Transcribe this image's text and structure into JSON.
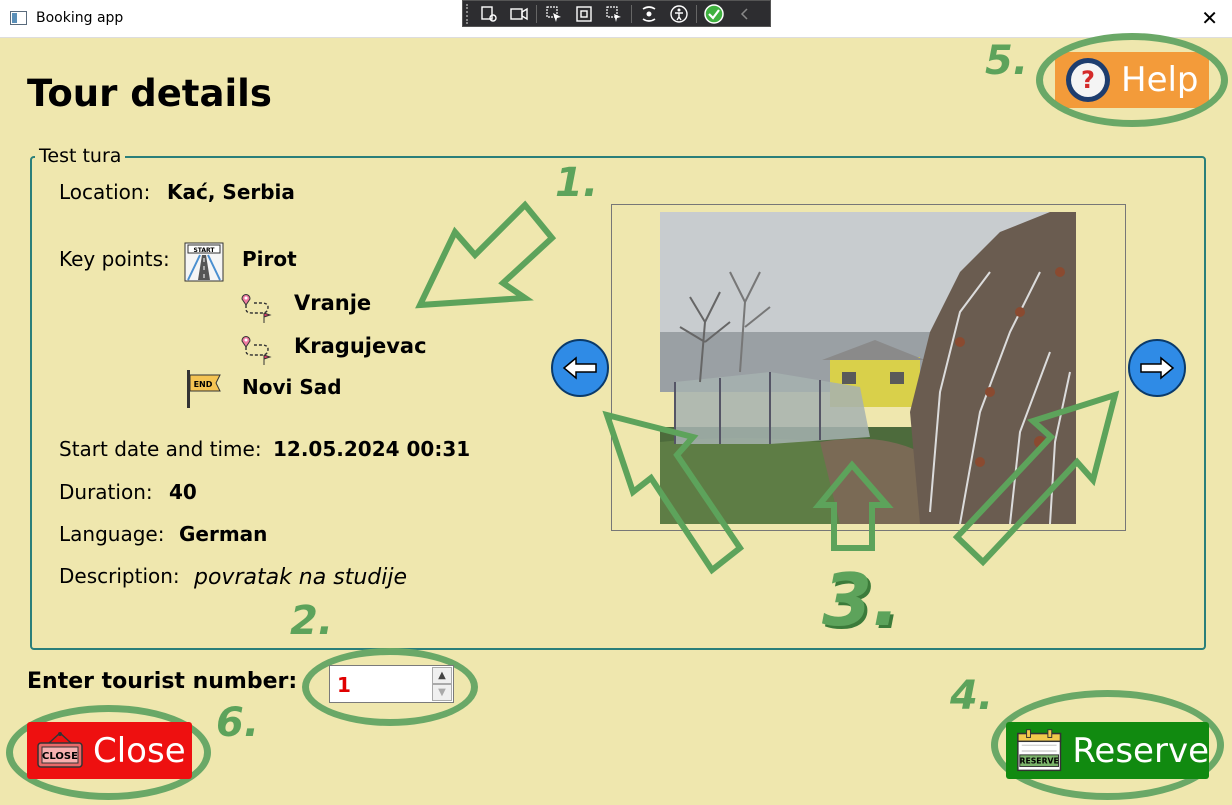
{
  "window": {
    "title": "Booking app",
    "close_glyph": "✕"
  },
  "page": {
    "title": "Tour details"
  },
  "tour": {
    "name": "Test tura",
    "location_label": "Location:",
    "location": "Kać, Serbia",
    "key_points_label": "Key points:",
    "key_points": [
      {
        "name": "Pirot",
        "icon": "start-road-icon"
      },
      {
        "name": "Vranje",
        "icon": "route-waypoint-icon"
      },
      {
        "name": "Kragujevac",
        "icon": "route-waypoint-icon"
      },
      {
        "name": "Novi Sad",
        "icon": "end-flag-icon"
      }
    ],
    "start_label": "Start date and time:",
    "start": "12.05.2024 00:31",
    "duration_label": "Duration:",
    "duration": "40",
    "language_label": "Language:",
    "language": "German",
    "description_label": "Description:",
    "description": "povratak na studije"
  },
  "carousel": {
    "prev_icon": "arrow-left-icon",
    "next_icon": "arrow-right-icon"
  },
  "tourist": {
    "label": "Enter tourist number:",
    "value": "1"
  },
  "buttons": {
    "help": "Help",
    "close": "Close",
    "reserve": "Reserve"
  },
  "annotations": {
    "n1": "1.",
    "n2": "2.",
    "n3": "3.",
    "n4": "4.",
    "n5": "5.",
    "n6": "6."
  },
  "colors": {
    "background": "#efe7ae",
    "help": "#f39b3a",
    "close": "#ee1010",
    "reserve": "#118a10",
    "annotation": "#5da35b",
    "group_border": "#2a7f7a",
    "nav_button": "#2f8be6",
    "tourist_value": "#e00000"
  }
}
